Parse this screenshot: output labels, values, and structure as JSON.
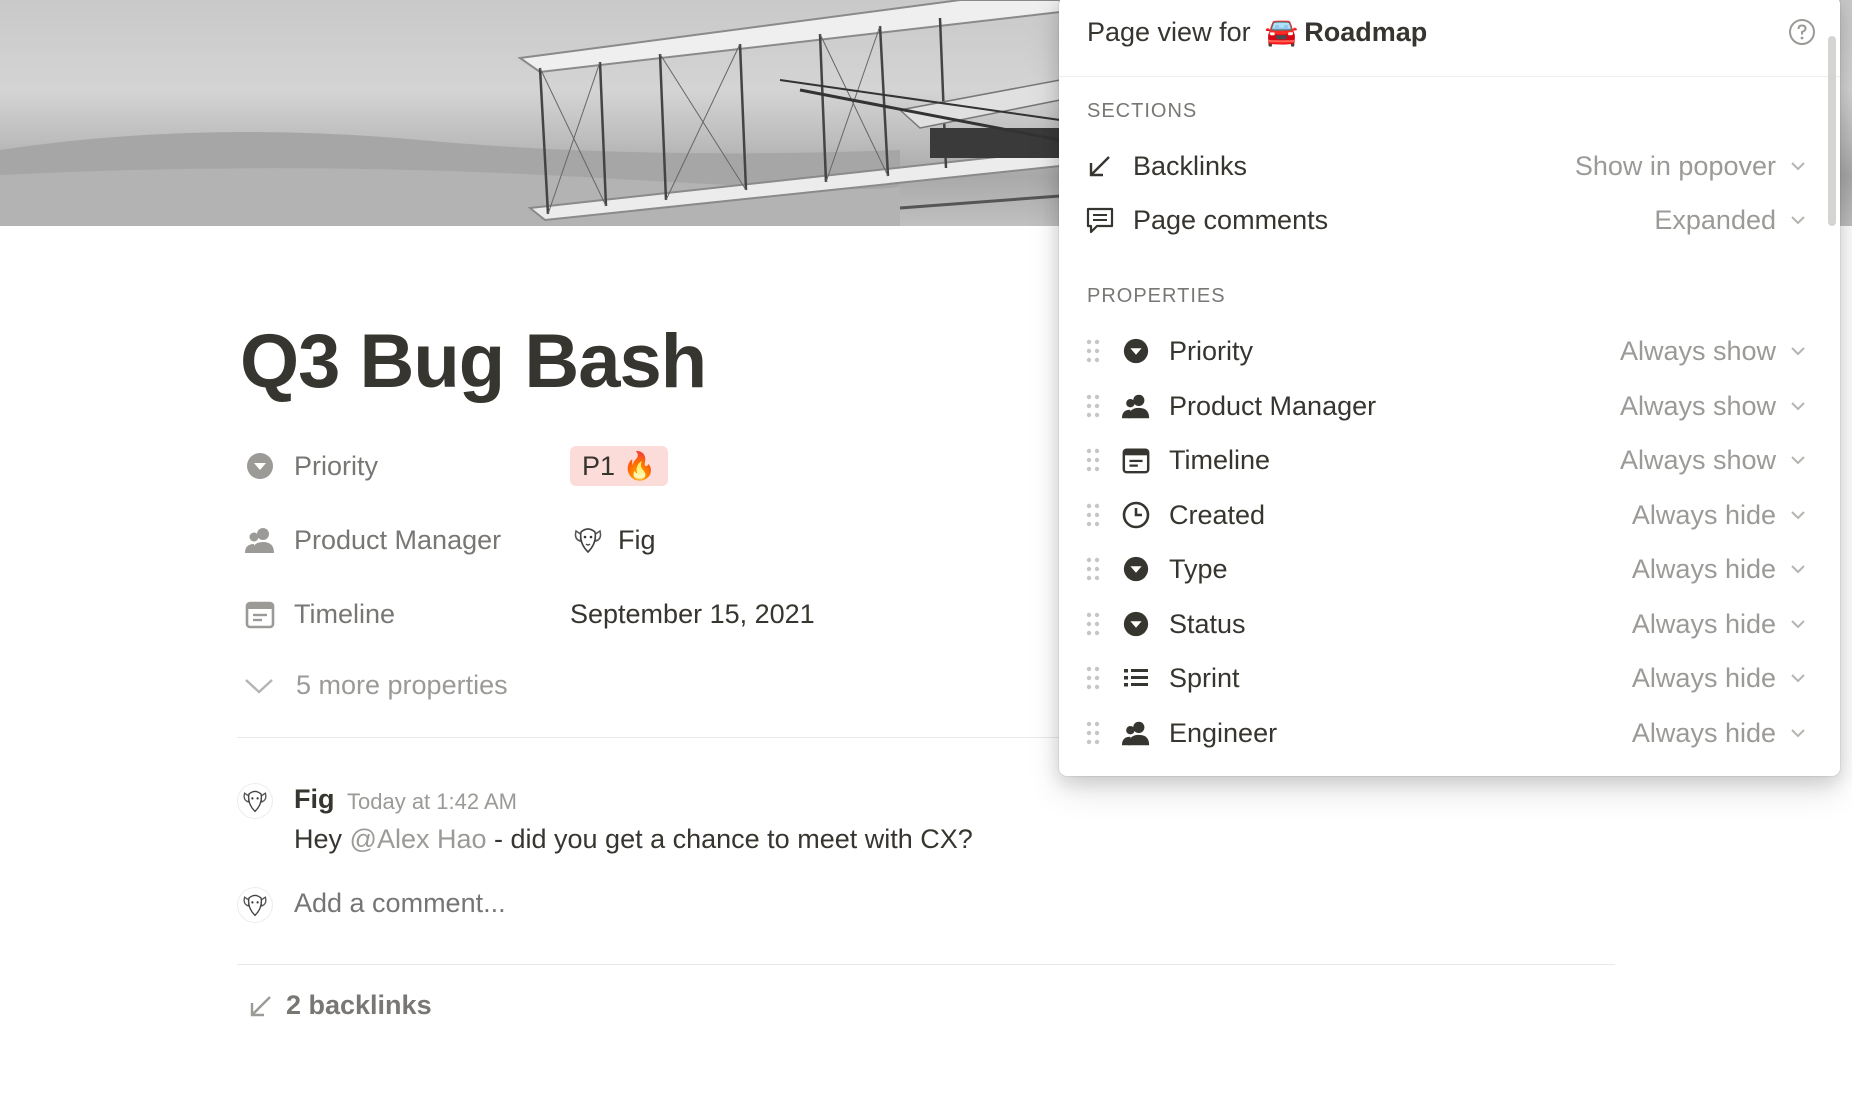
{
  "page": {
    "title": "Q3 Bug Bash",
    "properties": [
      {
        "name": "Priority",
        "icon": "select-icon",
        "value": "P1 🔥"
      },
      {
        "name": "Product Manager",
        "icon": "person-icon",
        "value": "Fig"
      },
      {
        "name": "Timeline",
        "icon": "calendar-icon",
        "value": "September 15, 2021"
      }
    ],
    "more_properties": "5 more properties"
  },
  "comment": {
    "author": "Fig",
    "time": "Today at 1:42 AM",
    "text_before": "Hey ",
    "mention": "@Alex Hao",
    "text_after": " - did you get a chance to meet with CX?",
    "add_placeholder": "Add a comment..."
  },
  "backlinks": {
    "label": "2 backlinks"
  },
  "popover": {
    "title_prefix": "Page view for",
    "page_emoji": "🚘",
    "page_name": "Roadmap",
    "sections_label": "SECTIONS",
    "sections": [
      {
        "name": "Backlinks",
        "icon": "backlink-arrow-icon",
        "value": "Show in popover"
      },
      {
        "name": "Page comments",
        "icon": "comment-icon",
        "value": "Expanded"
      }
    ],
    "properties_label": "PROPERTIES",
    "properties": [
      {
        "name": "Priority",
        "icon": "select-icon",
        "value": "Always show"
      },
      {
        "name": "Product Manager",
        "icon": "person-icon",
        "value": "Always show"
      },
      {
        "name": "Timeline",
        "icon": "calendar-icon",
        "value": "Always show"
      },
      {
        "name": "Created",
        "icon": "clock-icon",
        "value": "Always hide"
      },
      {
        "name": "Type",
        "icon": "select-icon",
        "value": "Always hide"
      },
      {
        "name": "Status",
        "icon": "select-icon",
        "value": "Always hide"
      },
      {
        "name": "Sprint",
        "icon": "list-icon",
        "value": "Always hide"
      },
      {
        "name": "Engineer",
        "icon": "person-icon",
        "value": "Always hide"
      }
    ]
  },
  "colors": {
    "text": "#37352f",
    "muted": "#787774",
    "light": "#9b9a97",
    "tag_red": "#fbdcd9"
  }
}
